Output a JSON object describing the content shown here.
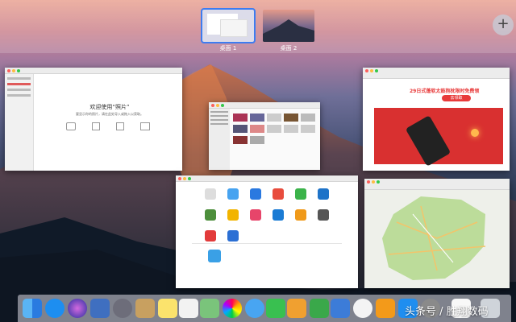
{
  "spaces": [
    {
      "label": "桌面 1",
      "active": true
    },
    {
      "label": "桌面 2",
      "active": false
    }
  ],
  "add_space_label": "+",
  "photos_window": {
    "welcome_title": "欢迎使用“照片”",
    "welcome_sub": "要显示你的照片，请在此处导入或拖入以获取。"
  },
  "store_window": {
    "promo_text": "29日式蓬软太鼓抱枕限时免费领",
    "button": "去领取"
  },
  "finder_window": {
    "sidebar_items": [
      "个人收藏",
      "iCloud Drive",
      "应用程序",
      "桌面",
      "文稿",
      "下载"
    ]
  },
  "watermark": "头条号 / 胜翔数码",
  "colors": {
    "accent": "#3d7cf0",
    "promo_red": "#e83a3a"
  }
}
